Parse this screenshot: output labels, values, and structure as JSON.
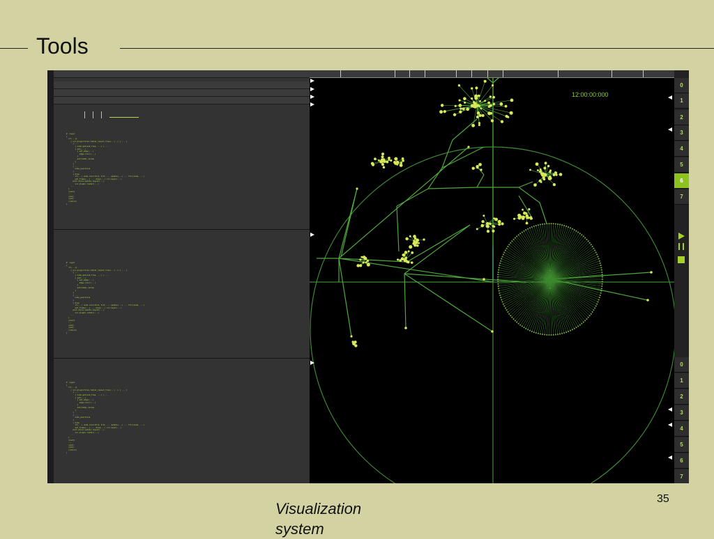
{
  "slide": {
    "title": "Tools",
    "page_number": "35",
    "caption": "Visualization system"
  },
  "app": {
    "clock": "12:00:00:000",
    "code_blocks": [
      "#  Layer\n{\n  if(...){\n    { viz.plugin=tree.radial_layout_tree(...) -> { ... }\n      { ...\n        { node.get(sub_tree, ...) } ...\n        { set(...)\n          { set_edge(...)\n            edge.color(...)\n          }\n          set(label_value)\n        }\n      }\n      { ...\n        node_positions\n      }\n      { draw\n        if(...) node.color=0.8, 0.8; ... update(...) ... fill(node, ...)\n        set_frame(...) ... draw(...) viz.layer(...)\n      plot.style.update.layout(...)\n        viz.plugin.render(...)\n    ...\n  }\n  (next)\n  ...\n  (end)\n  (end)\n  (return)\n}",
      "#  Layer\n{\n  if(...){\n    { viz.plugin=tree.radial_layout_tree(...) -> { ... }\n      { ...\n        { node.get(sub_tree, ...) } ...\n        { set(...)\n          { set_edge(...)\n            edge.color(...)\n          }\n          set(label_value)\n        }\n      }\n      { ...\n        node_positions\n      }\n      { draw\n        if(...) node.color=0.8, 0.8; ... update(...) ... fill(node, ...)\n        set_frame(...) ... draw(...) viz.layer(...)\n      plot.style.update.layout(...)\n        viz.plugin.render(...)\n    ...\n  }\n  (next)\n  ...\n  (end)\n  (end)\n  (return)\n}",
      "#  Layer\n{\n  if(...){\n    { viz.plugin=tree.radial_layout_tree(...) -> { ... }\n      { ...\n        { node.get(sub_tree, ...) } ...\n        { set(...)\n          { set_edge(...)\n            edge.color(...)\n          }\n          set(label_value)\n        }\n      }\n      { ...\n        node_positions\n      }\n      { draw\n        if(...) node.color=0.8, 0.8; ... update(...) ... fill(node, ...)\n        set_frame(...) ... draw(...) viz.layer(...)\n      plot.style.update.layout(...)\n        viz.plugin.render(...)\n    ...\n  }\n  (next)\n  ...\n  (end)\n  (end)\n  (return)\n}"
    ],
    "rightbar": {
      "top_buttons": [
        "0",
        "1",
        "2",
        "3",
        "4",
        "5",
        "6",
        "7"
      ],
      "active_top": "6",
      "bottom_buttons": [
        "0",
        "1",
        "2",
        "3",
        "4",
        "5",
        "6",
        "7"
      ],
      "controls": [
        "play-icon",
        "pause-icon",
        "stop-icon"
      ]
    },
    "colors": {
      "background": "#000000",
      "panel": "#333333",
      "accent": "#8dc21f",
      "graph": "#4caf3a",
      "node": "#d8e85a"
    }
  }
}
